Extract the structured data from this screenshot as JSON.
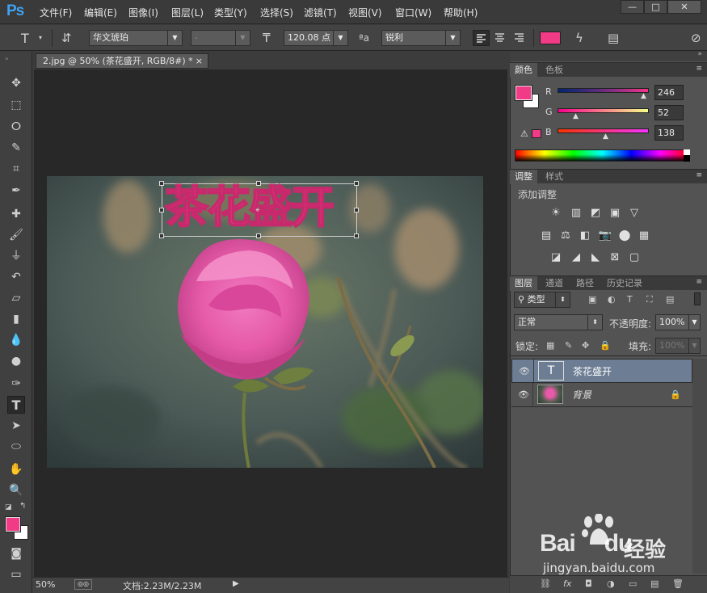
{
  "app": {
    "logo": "Ps"
  },
  "menu": [
    "文件(F)",
    "编辑(E)",
    "图像(I)",
    "图层(L)",
    "类型(Y)",
    "选择(S)",
    "滤镜(T)",
    "视图(V)",
    "窗口(W)",
    "帮助(H)"
  ],
  "window_controls": [
    "—",
    "□",
    "✕"
  ],
  "options": {
    "font_family": "华文琥珀",
    "font_style": "-",
    "font_size": "120.08 点",
    "antialias_label": "a",
    "antialias": "锐利",
    "text_color": "#f13b86"
  },
  "document": {
    "tab_title": "2.jpg @ 50% (茶花盛开, RGB/8#) *",
    "close": "×",
    "text_layer": "茶花盛开"
  },
  "status": {
    "zoom": "50%",
    "doc_info": "文档:2.23M/2.23M"
  },
  "colors": {
    "foreground": "#f13b86",
    "background": "#ffffff",
    "accent": "#3fa2f2"
  },
  "color_panel": {
    "tabs": [
      "颜色",
      "色板"
    ],
    "channels": [
      {
        "label": "R",
        "value": "246",
        "fraction": 0.96
      },
      {
        "label": "G",
        "value": "52",
        "fraction": 0.2
      },
      {
        "label": "B",
        "value": "138",
        "fraction": 0.54
      }
    ]
  },
  "adjust_panel": {
    "tabs": [
      "调整",
      "样式"
    ],
    "title": "添加调整",
    "row1": [
      "☀",
      "▥",
      "◩",
      "▣",
      "▽"
    ],
    "row2": [
      "▤",
      "⚖",
      "◧",
      "📷",
      "⬤",
      "▦"
    ],
    "row3": [
      "◪",
      "◢",
      "◣",
      "⊠",
      "▢"
    ]
  },
  "layers_panel": {
    "tabs": [
      "图层",
      "通道",
      "路径",
      "历史记录"
    ],
    "filter_kind": "类型",
    "blend_mode": "正常",
    "opacity_label": "不透明度:",
    "opacity": "100%",
    "lock_label": "锁定:",
    "fill_label": "填充:",
    "fill": "100%",
    "layers": [
      {
        "name": "茶花盛开",
        "type": "text",
        "thumb": "T",
        "selected": true
      },
      {
        "name": "背景",
        "type": "image",
        "selected": false,
        "locked": true
      }
    ],
    "bottom_icons": [
      "⛓",
      "fx",
      "◘",
      "◑",
      "▭",
      "▤",
      "🗑"
    ]
  },
  "watermark": {
    "brand": "Bai",
    "brand_mid": "du",
    "product": "经验",
    "url": "jingyan.baidu.com"
  }
}
